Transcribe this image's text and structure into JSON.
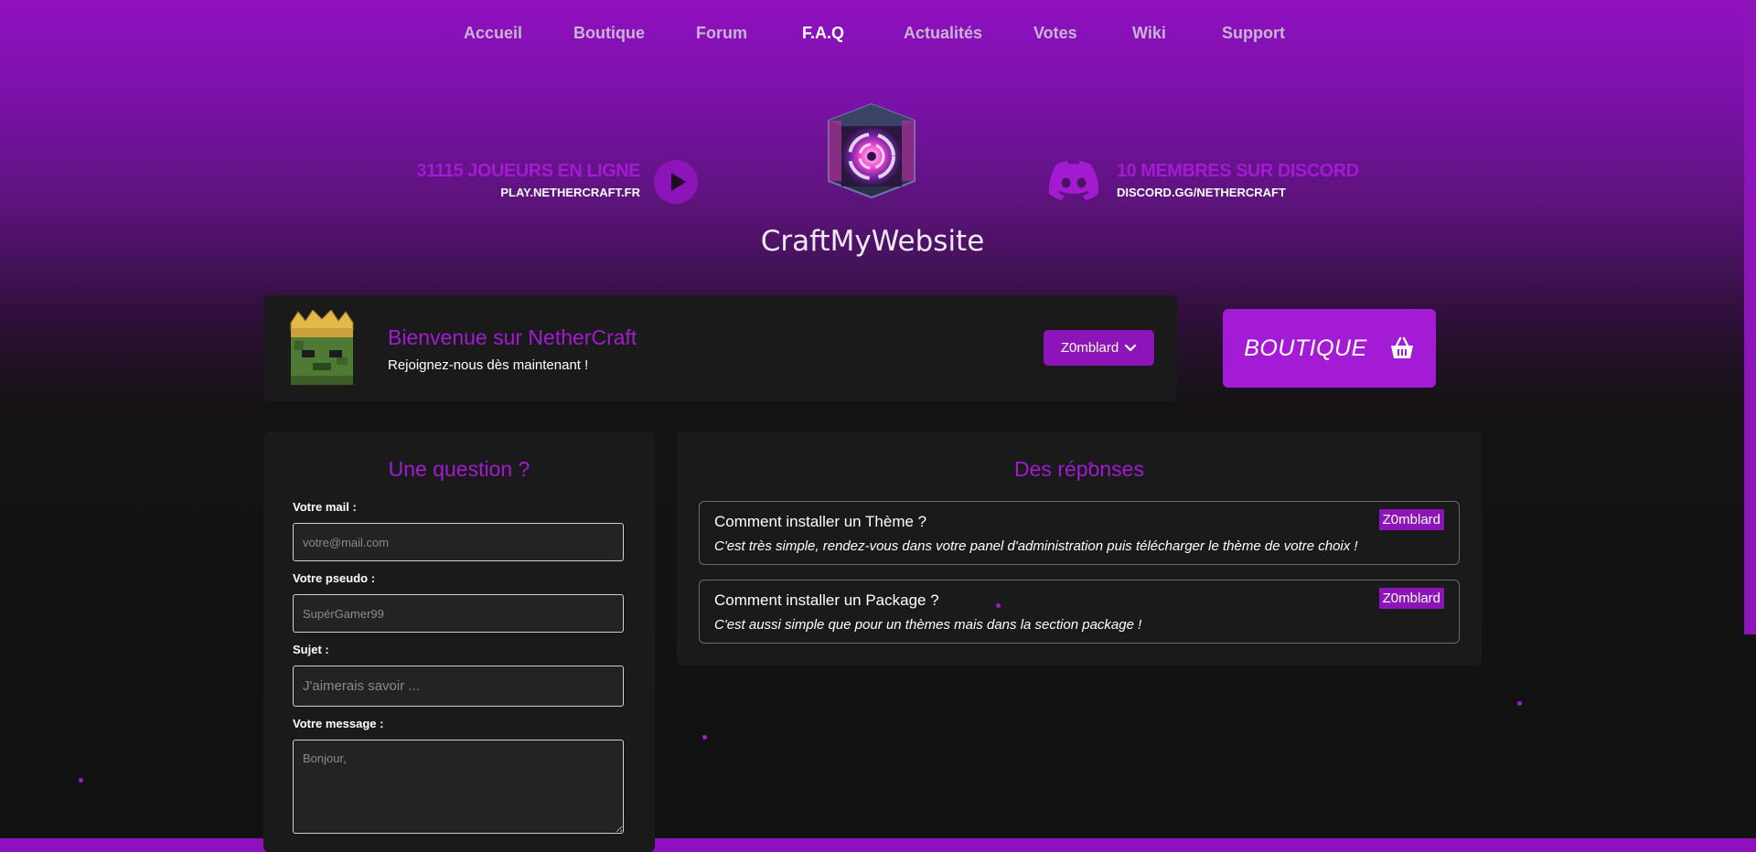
{
  "nav": {
    "items": [
      {
        "label": "Accueil",
        "active": false
      },
      {
        "label": "Boutique",
        "active": false
      },
      {
        "label": "Forum",
        "active": false
      },
      {
        "label": "F.A.Q",
        "active": true
      },
      {
        "label": "Actualités",
        "active": false
      },
      {
        "label": "Votes",
        "active": false
      },
      {
        "label": "Wiki",
        "active": false
      },
      {
        "label": "Support",
        "active": false
      }
    ]
  },
  "header": {
    "players_online": "31115 JOUEURS EN LIGNE",
    "server_ip": "PLAY.NETHERCRAFT.FR",
    "discord_members": "10 MEMBRES SUR DISCORD",
    "discord_link": "DISCORD.GG/NETHERCRAFT",
    "site_name": "CraftMyWebsite"
  },
  "welcome": {
    "title": "Bienvenue sur NetherCraft",
    "subtitle": "Rejoignez-nous dès maintenant !",
    "user_button": "Z0mblard"
  },
  "shop_button": "BOUTIQUE",
  "question_form": {
    "title": "Une question ?",
    "email_label": "Votre mail :",
    "email_placeholder": "votre@mail.com",
    "pseudo_label": "Votre pseudo :",
    "pseudo_placeholder": "SupérGamer99",
    "subject_label": "Sujet :",
    "subject_placeholder": "J'aimerais savoir ...",
    "message_label": "Votre message :",
    "message_placeholder": "Bonjour,"
  },
  "answers": {
    "title": "Des réponses",
    "items": [
      {
        "question": "Comment installer un Thème ?",
        "answer": "C'est très simple, rendez-vous dans votre panel d'administration puis télécharger le thème de votre choix !",
        "author": "Z0mblard"
      },
      {
        "question": "Comment installer un Package ?",
        "answer": "C'est aussi simple que pour un thèmes mais dans la section package !",
        "author": "Z0mblard"
      }
    ]
  },
  "colors": {
    "accent": "#a21bd0",
    "button": "#8d14b8",
    "panel": "#1a1a1a",
    "background": "#111111"
  },
  "icons": {
    "play": "play-circle-icon",
    "discord": "discord-icon",
    "dropdown": "chevron-down-icon",
    "basket": "shopping-basket-icon"
  }
}
